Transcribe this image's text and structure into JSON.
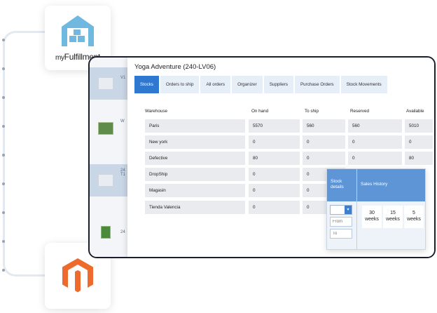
{
  "logos": {
    "myfulfillment_prefix": "my",
    "myfulfillment_name": "Fulfillment",
    "brand_color": "#6fb8e0",
    "magento_color": "#ec6b2d"
  },
  "window": {
    "title": "Yoga Adventure (240-LV06)",
    "tabs": [
      {
        "label": "Stocks",
        "active": true
      },
      {
        "label": "Orders to ship",
        "active": false
      },
      {
        "label": "All orders",
        "active": false
      },
      {
        "label": "Organizer",
        "active": false
      },
      {
        "label": "Suppliers",
        "active": false
      },
      {
        "label": "Purchase Orders",
        "active": false
      },
      {
        "label": "Stock Movements",
        "active": false
      }
    ],
    "accent_color": "#2f78d1"
  },
  "background_list": {
    "items": [
      "V1",
      "W",
      "24 T1",
      "24"
    ]
  },
  "stock_table": {
    "headers": {
      "warehouse": "Warehouse",
      "on_hand": "On hand",
      "to_ship": "To ship",
      "reserved": "Reserved",
      "available": "Available"
    },
    "rows": [
      {
        "warehouse": "Paris",
        "on_hand": "5570",
        "to_ship": "560",
        "reserved": "560",
        "available": "5010"
      },
      {
        "warehouse": "New york",
        "on_hand": "0",
        "to_ship": "0",
        "reserved": "0",
        "available": "0"
      },
      {
        "warehouse": "Defective",
        "on_hand": "80",
        "to_ship": "0",
        "reserved": "0",
        "available": "80"
      },
      {
        "warehouse": "DropShip",
        "on_hand": "0",
        "to_ship": "0"
      },
      {
        "warehouse": "Magasin",
        "on_hand": "0",
        "to_ship": "0"
      },
      {
        "warehouse": "Tienda Valencia",
        "on_hand": "0",
        "to_ship": "0"
      }
    ]
  },
  "stock_popup": {
    "stock_details": "Stock details",
    "sales_history": "Sales History",
    "from_placeholder": "From",
    "to_placeholder": "To",
    "weeks": [
      {
        "num": "30",
        "unit": "weeks"
      },
      {
        "num": "15",
        "unit": "weeks"
      },
      {
        "num": "5",
        "unit": "weeks"
      }
    ]
  }
}
